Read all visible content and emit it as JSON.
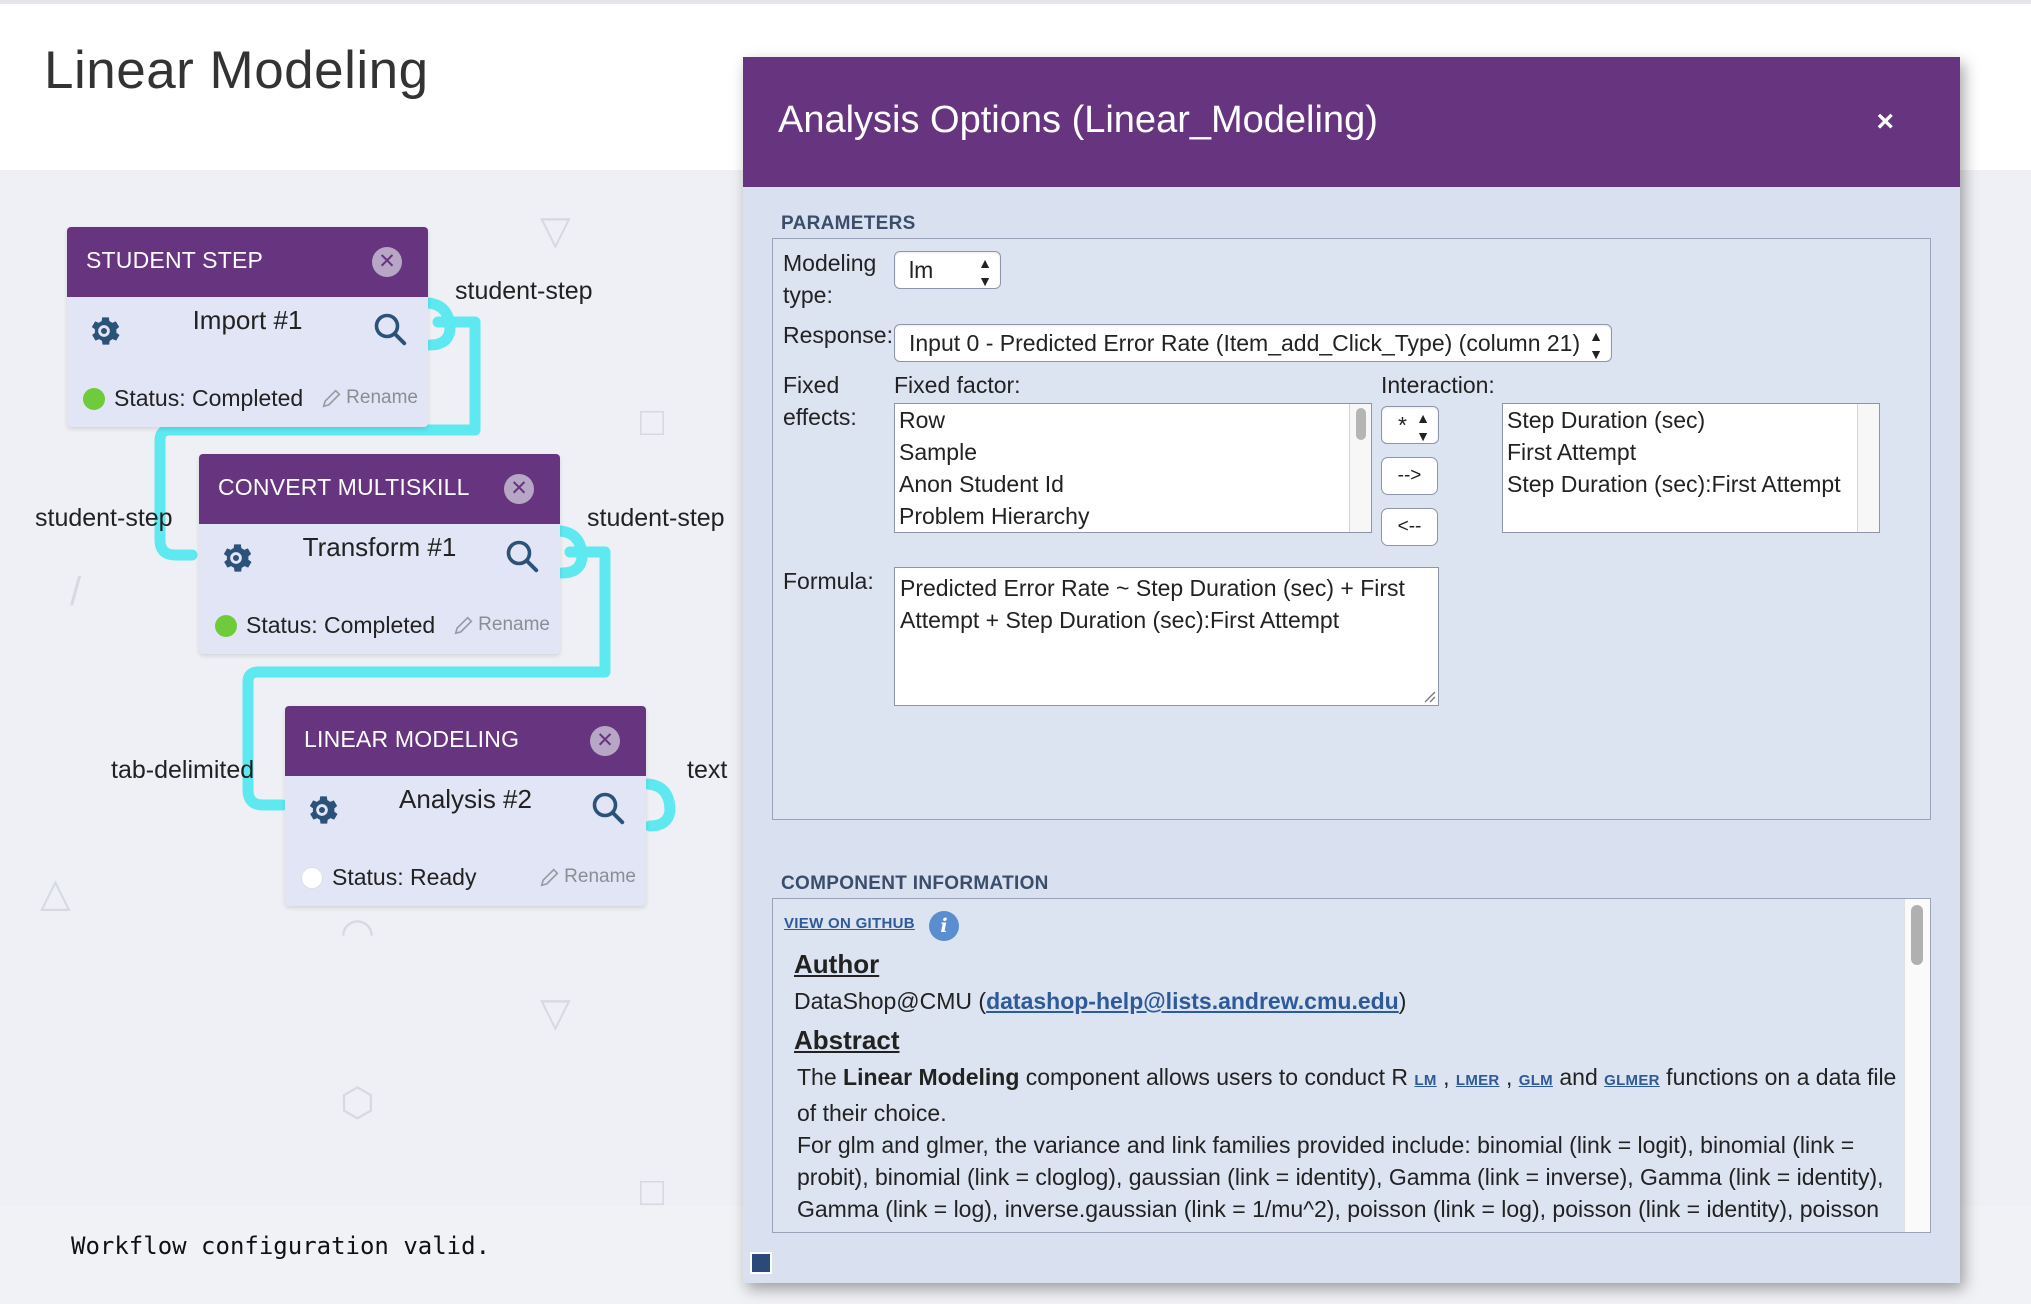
{
  "page": {
    "title": "Linear Modeling",
    "status_message": "Workflow configuration valid."
  },
  "nodes": [
    {
      "type": "STUDENT STEP",
      "name": "Import #1",
      "status": "Status: Completed",
      "status_color": "#6fca3c",
      "rename": "Rename"
    },
    {
      "type": "CONVERT MULTISKILL",
      "name": "Transform #1",
      "status": "Status: Completed",
      "status_color": "#6fca3c",
      "rename": "Rename"
    },
    {
      "type": "LINEAR MODELING",
      "name": "Analysis #2",
      "status": "Status: Ready",
      "status_color": "#ffffff",
      "rename": "Rename"
    }
  ],
  "ports": {
    "import_out": "student-step",
    "transform_in": "student-step",
    "transform_out": "student-step",
    "analysis_in": "tab-delimited",
    "analysis_out": "text"
  },
  "colors": {
    "node_header": "#67357f",
    "connector": "#5ee8f0",
    "link": "#2e5a9a"
  },
  "dialog": {
    "title": "Analysis Options (Linear_Modeling)",
    "close_symbol": "×",
    "parameters_label": "PARAMETERS",
    "modeling_type_label_1": "Modeling",
    "modeling_type_label_2": "type:",
    "modeling_type_value": "lm",
    "response_label": "Response:",
    "response_value": "Input 0 - Predicted Error Rate (Item_add_Click_Type) (column 21)",
    "fixed_effects_label_1": "Fixed",
    "fixed_effects_label_2": "effects:",
    "fixed_factor_label": "Fixed factor:",
    "fixed_factor_items": [
      "Row",
      "Sample",
      "Anon Student Id",
      "Problem Hierarchy"
    ],
    "interaction_label": "Interaction:",
    "interaction_operator": "*",
    "add_button": "-->",
    "remove_button": "<--",
    "interaction_items": [
      "Step Duration (sec)",
      "First Attempt",
      "Step Duration (sec):First Attempt"
    ],
    "formula_label": "Formula:",
    "formula_line_1": "Predicted Error Rate ~ Step Duration (sec) + First",
    "formula_line_2": "Attempt + Step Duration (sec):First Attempt",
    "component_info_label": "COMPONENT INFORMATION",
    "github_link": "VIEW ON GITHUB",
    "info_icon": "i",
    "author_heading": "Author",
    "author_name": "DataShop@CMU (",
    "author_email": "datashop-help@lists.andrew.cmu.edu",
    "author_close": ")",
    "abstract_heading": "Abstract",
    "abstract_pre": "The ",
    "abstract_bold": "Linear Modeling",
    "abstract_mid": " component allows users to conduct R ",
    "fn_lm": "LM",
    "fn_lmer": "LMER",
    "fn_glm": "GLM",
    "fn_glmer": "GLMER",
    "sep_comma": " , ",
    "sep_and": " and ",
    "abstract_tail": " functions on a data file of their choice.",
    "abstract_p2": "For glm and glmer, the variance and link families provided include: binomial (link = logit), binomial (link = probit), binomial (link = cloglog), gaussian (link = identity), Gamma (link = inverse), Gamma (link = identity), Gamma (link = log), inverse.gaussian (link = 1/mu^2), poisson (link = log), poisson (link = identity), poisson (link = sqrt)."
  }
}
